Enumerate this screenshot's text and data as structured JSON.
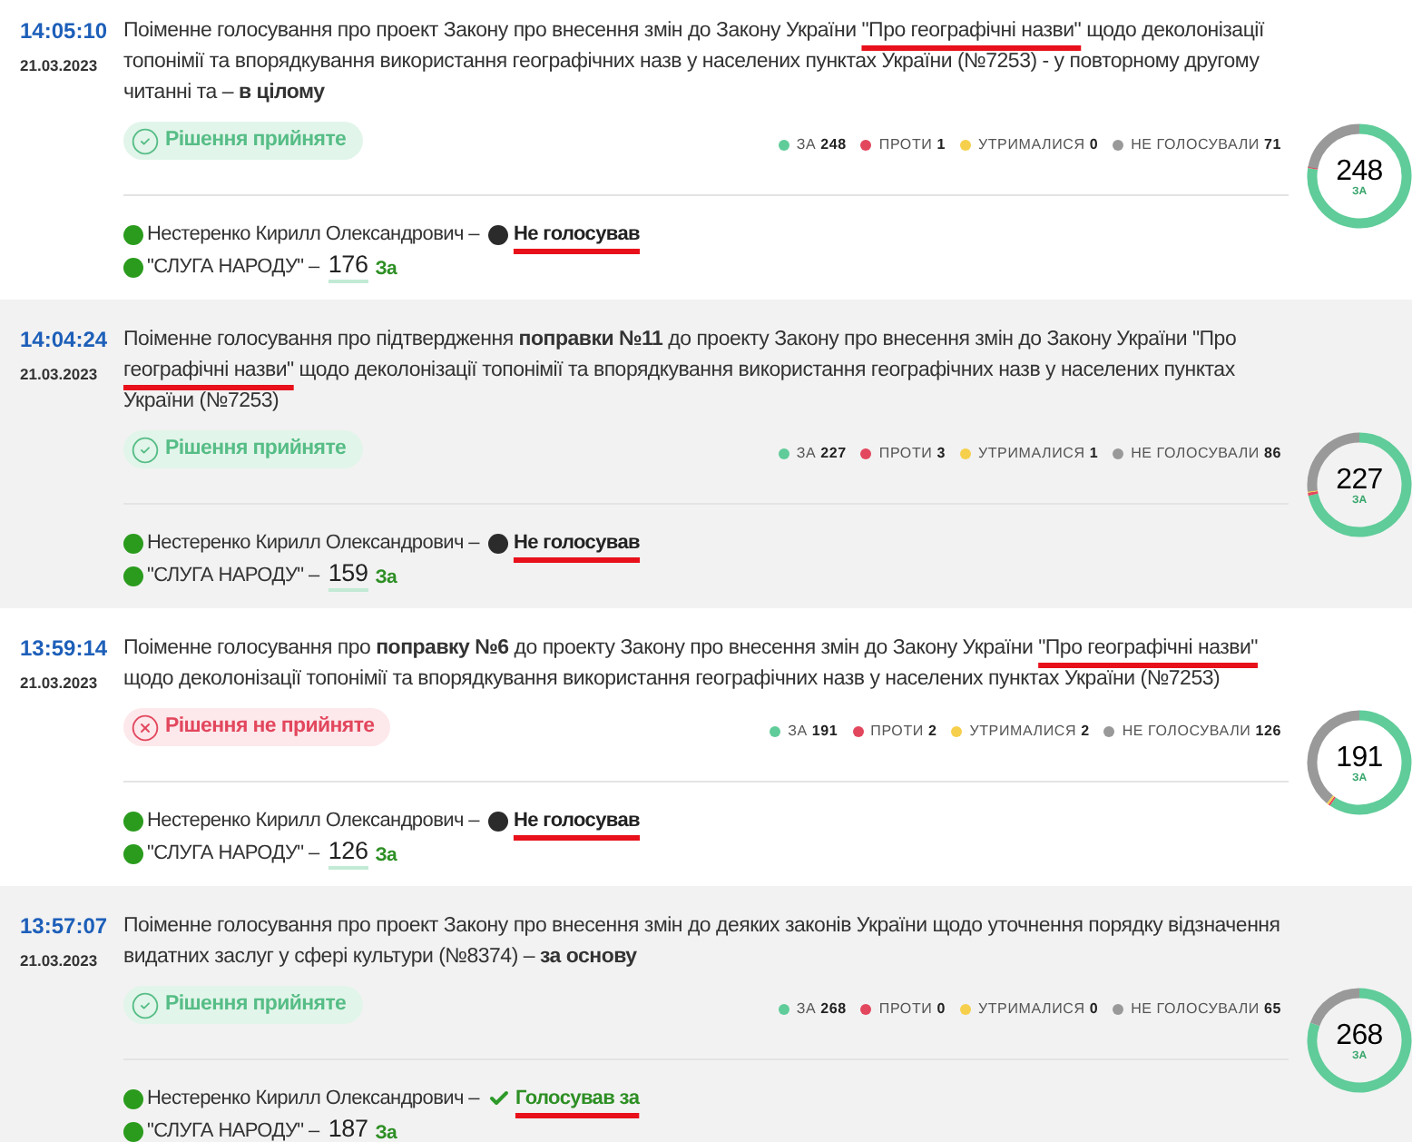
{
  "votes": [
    {
      "time": "14:05:10",
      "date": "21.03.2023",
      "description": [
        {
          "text": "Поіменне голосування про проект Закону про внесення змін до Закону України "
        },
        {
          "text": "\"Про географічні назви\"",
          "marked": true
        },
        {
          "text": " щодо деколонізації топонімії та впорядкування використання географічних назв у населених пунктах України (№7253) - у повторному другому читанні та – **в цілому**"
        }
      ],
      "decision": {
        "kind": "accepted",
        "text": "Рішення прийняте"
      },
      "tally": [
        {
          "label": "ЗА",
          "count": "248",
          "color": "#5fcc99"
        },
        {
          "label": "ПРОТИ",
          "count": "1",
          "color": "#e2475d"
        },
        {
          "label": "УТРИМАЛИСЯ",
          "count": "0",
          "color": "#f6cf4c"
        },
        {
          "label": "НЕ ГОЛОСУВАЛИ",
          "count": "71",
          "color": "#999999"
        }
      ],
      "donut": {
        "value": "248",
        "label": "ЗА"
      },
      "deputy": {
        "name": "Нестеренко Кирилл Олександрович –",
        "vote": {
          "kind": "absent",
          "text": "Не голосував",
          "marked": true
        }
      },
      "faction": {
        "name": "\"СЛУГА НАРОДУ\" –",
        "count": "176",
        "vote": "За"
      }
    },
    {
      "time": "14:04:24",
      "date": "21.03.2023",
      "description": [
        {
          "text": "Поіменне голосування про підтвердження **поправки №11** до проекту Закону про внесення змін до Закону України \"Про "
        },
        {
          "text": "географічні назви\"",
          "marked": true
        },
        {
          "text": " щодо деколонізації топонімії та впорядкування використання географічних назв у населених пунктах України (№7253)"
        }
      ],
      "decision": {
        "kind": "accepted",
        "text": "Рішення прийняте"
      },
      "tally": [
        {
          "label": "ЗА",
          "count": "227",
          "color": "#5fcc99"
        },
        {
          "label": "ПРОТИ",
          "count": "3",
          "color": "#e2475d"
        },
        {
          "label": "УТРИМАЛИСЯ",
          "count": "1",
          "color": "#f6cf4c"
        },
        {
          "label": "НЕ ГОЛОСУВАЛИ",
          "count": "86",
          "color": "#999999"
        }
      ],
      "donut": {
        "value": "227",
        "label": "ЗА"
      },
      "deputy": {
        "name": "Нестеренко Кирилл Олександрович –",
        "vote": {
          "kind": "absent",
          "text": "Не голосував",
          "marked": true
        }
      },
      "faction": {
        "name": "\"СЛУГА НАРОДУ\" –",
        "count": "159",
        "vote": "За"
      }
    },
    {
      "time": "13:59:14",
      "date": "21.03.2023",
      "description": [
        {
          "text": "Поіменне голосування про **поправку №6** до проекту Закону про внесення змін до Закону України "
        },
        {
          "text": "\"Про географічні назви\"",
          "marked": true
        },
        {
          "text": " щодо деколонізації топонімії та впорядкування використання географічних назв у населених пунктах України (№7253)"
        }
      ],
      "decision": {
        "kind": "rejected",
        "text": "Рішення не прийняте"
      },
      "tally": [
        {
          "label": "ЗА",
          "count": "191",
          "color": "#5fcc99"
        },
        {
          "label": "ПРОТИ",
          "count": "2",
          "color": "#e2475d"
        },
        {
          "label": "УТРИМАЛИСЯ",
          "count": "2",
          "color": "#f6cf4c"
        },
        {
          "label": "НЕ ГОЛОСУВАЛИ",
          "count": "126",
          "color": "#999999"
        }
      ],
      "donut": {
        "value": "191",
        "label": "ЗА"
      },
      "deputy": {
        "name": "Нестеренко Кирилл Олександрович –",
        "vote": {
          "kind": "absent",
          "text": "Не голосував",
          "marked": true
        }
      },
      "faction": {
        "name": "\"СЛУГА НАРОДУ\" –",
        "count": "126",
        "vote": "За"
      }
    },
    {
      "time": "13:57:07",
      "date": "21.03.2023",
      "description": [
        {
          "text": "Поіменне голосування про проект Закону про внесення змін до деяких законів України щодо уточнення порядку відзначення видатних заслуг у сфері культури (№8374) – **за основу**"
        }
      ],
      "decision": {
        "kind": "accepted",
        "text": "Рішення прийняте"
      },
      "tally": [
        {
          "label": "ЗА",
          "count": "268",
          "color": "#5fcc99"
        },
        {
          "label": "ПРОТИ",
          "count": "0",
          "color": "#e2475d"
        },
        {
          "label": "УТРИМАЛИСЯ",
          "count": "0",
          "color": "#f6cf4c"
        },
        {
          "label": "НЕ ГОЛОСУВАЛИ",
          "count": "65",
          "color": "#999999"
        }
      ],
      "donut": {
        "value": "268",
        "label": "ЗА"
      },
      "deputy": {
        "name": "Нестеренко Кирилл Олександрович –",
        "vote": {
          "kind": "for",
          "text": "Голосував за",
          "marked": true
        }
      },
      "faction": {
        "name": "\"СЛУГА НАРОДУ\" –",
        "count": "187",
        "vote": "За"
      }
    }
  ]
}
